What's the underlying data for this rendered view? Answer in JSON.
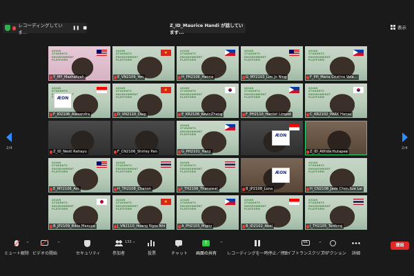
{
  "topbar": {
    "recording_text": "レコーディングしていま...",
    "pause_glyph": "❚❚",
    "stop_glyph": "■",
    "speaker": "Z_ID_Maurice  Handi が話しています...",
    "view_label": "表示"
  },
  "pager": {
    "left_label": "2/4",
    "right_label": "2/4"
  },
  "tiles": [
    {
      "name": "Y_MY_Mazhalizah",
      "flag": "my"
    },
    {
      "name": "E_VN2109_Yen",
      "flag": "vn"
    },
    {
      "name": "H_PH2106_Hanna",
      "flag": "ph"
    },
    {
      "name": "G_MY2103_Lim Jo Ning",
      "flag": "my"
    },
    {
      "name": "F_PH_Maria Cristina Vela...",
      "flag": "ph"
    },
    {
      "name": "F_ID2106_Alexandra",
      "flag": "id"
    },
    {
      "name": "D_VN2110_Diep",
      "flag": "vn"
    },
    {
      "name": "E_KR2106_KevinZhang",
      "flag": "kr"
    },
    {
      "name": "F_PH2110_Harriet Limpot",
      "flag": "ph"
    },
    {
      "name": "C_KR2102_PARK Hansu",
      "flag": "kr"
    },
    {
      "name": "Z_ID_Nesti Rahayu",
      "flag": ""
    },
    {
      "name": "F_CN2106_Shirley Pan",
      "flag": ""
    },
    {
      "name": "G_PH2101_Hanz",
      "flag": "ph"
    },
    {
      "name": "",
      "flag": "id"
    },
    {
      "name": "Z_ID_Alfrida Hutapea",
      "flag": ""
    },
    {
      "name": "E_MY2106_Ain",
      "flag": "my"
    },
    {
      "name": "H_TH2108_Chanon",
      "flag": "th"
    },
    {
      "name": "I_TH2106_Thanawat",
      "flag": "th"
    },
    {
      "name": "B_JP2108_Luna",
      "flag": ""
    },
    {
      "name": "H_CN2108_Jade Chen Sze Lai",
      "flag": ""
    },
    {
      "name": "B_JP2109_Rikio Masuya",
      "flag": "jp"
    },
    {
      "name": "J_VN2110_Hoang Ngoc Nhi",
      "flag": "vn"
    },
    {
      "name": "A_PH2103_Migoy",
      "flag": "ph"
    },
    {
      "name": "B_ID2102_Abel",
      "flag": "id"
    },
    {
      "name": "I_TH2105_Tonfong",
      "flag": "th"
    }
  ],
  "logo_lines": [
    "ASIAN",
    "STUDENTS",
    "ENVIRONMENT",
    "PLATFORM"
  ],
  "aeon_text": "ÆON",
  "toolbar": {
    "mute": "ミュート解除",
    "video": "ビデオの開始",
    "security": "セキュリティ",
    "participants": "参加者",
    "participants_count": "133",
    "polls": "投票",
    "chat": "チャット",
    "share": "画面の共有",
    "share_glyph": "↑",
    "recording": "レコーディングを一時停止／停止",
    "transcript": "ライブトランスクリプト",
    "cc_glyph": "CC",
    "reactions": "リアクション",
    "more": "詳細",
    "leave": "退出",
    "caret_glyph": "^"
  },
  "colors": {
    "accent_blue": "#2d8cff",
    "leave_red": "#e02828",
    "share_green": "#2ecc40",
    "active_speaker_green": "#2ed573"
  }
}
